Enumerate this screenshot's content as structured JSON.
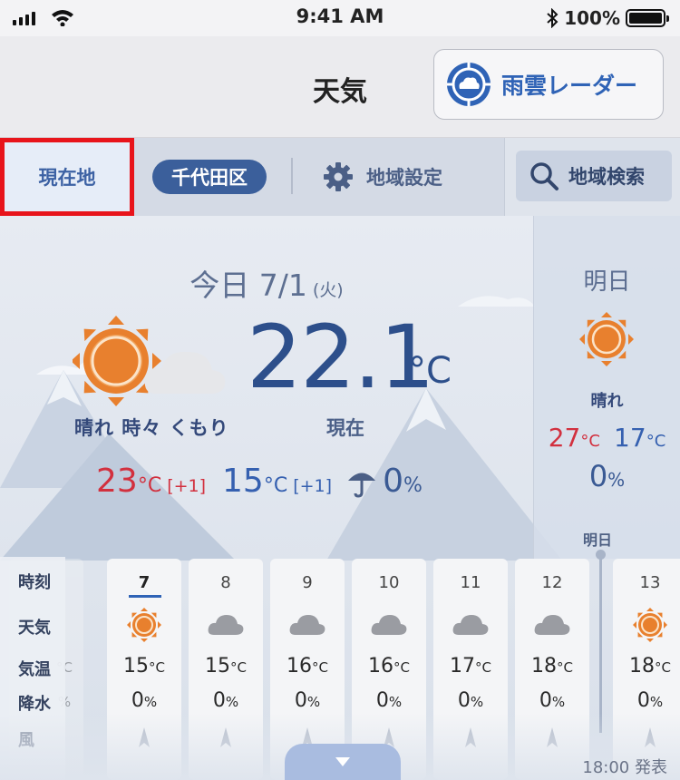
{
  "status_bar": {
    "time": "9:41 AM",
    "battery": "100%"
  },
  "header": {
    "title": "天気",
    "radar_button": "雨雲レーダー"
  },
  "location_bar": {
    "current_location": "現在地",
    "area_name": "千代田区",
    "settings_label": "地域設定",
    "search_label": "地域検索"
  },
  "today": {
    "date_main": "今日 7/1",
    "date_weekday": "(火)",
    "current_temp": "22.1",
    "temp_unit": "°C",
    "condition": "晴れ 時々 くもり",
    "now_label": "現在",
    "high": "23",
    "high_diff": "[+1]",
    "low": "15",
    "low_diff": "[+1]",
    "rain_chance": "0",
    "unit_c": "°C",
    "unit_pct": "%",
    "icon": "sun-and-cloud"
  },
  "tomorrow": {
    "title": "明日",
    "condition": "晴れ",
    "high": "27",
    "low": "17",
    "rain_chance": "0",
    "unit_c": "°C",
    "unit_pct": "%",
    "icon": "sun"
  },
  "hourly": {
    "labels": {
      "time": "時刻",
      "weather": "天気",
      "temp": "気温",
      "rain": "降水",
      "wind": "風"
    },
    "tomorrow_marker": "明日",
    "issued": "18:00 発表",
    "unit_c": "°C",
    "unit_pct": "%",
    "hours": [
      {
        "time": "7",
        "icon": "sun",
        "temp": "15",
        "rain": "0"
      },
      {
        "time": "8",
        "icon": "cloud",
        "temp": "15",
        "rain": "0"
      },
      {
        "time": "9",
        "icon": "cloud",
        "temp": "16",
        "rain": "0"
      },
      {
        "time": "10",
        "icon": "cloud",
        "temp": "16",
        "rain": "0"
      },
      {
        "time": "11",
        "icon": "cloud",
        "temp": "17",
        "rain": "0"
      },
      {
        "time": "12",
        "icon": "cloud",
        "temp": "18",
        "rain": "0"
      },
      {
        "time": "13",
        "icon": "sun",
        "temp": "18",
        "rain": "0"
      }
    ],
    "partial_left": {
      "temp_unit": "°C",
      "rain_unit": "%"
    }
  },
  "colors": {
    "accent": "#2f63b6",
    "high": "#d2303e",
    "low": "#3560b0",
    "highlight_border": "#e8141b"
  }
}
